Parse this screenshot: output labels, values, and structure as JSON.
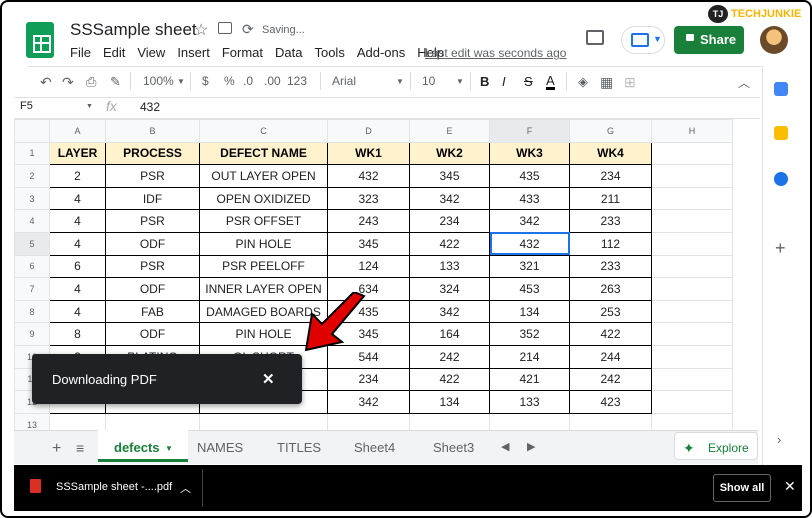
{
  "watermark": {
    "badge": "TJ",
    "brand": "TECHJUNKIE"
  },
  "header": {
    "title": "SSSample sheet",
    "saving": "Saving...",
    "last_edit": "Last edit was seconds ago",
    "share_label": "Share"
  },
  "menu": [
    "File",
    "Edit",
    "View",
    "Insert",
    "Format",
    "Data",
    "Tools",
    "Add-ons",
    "Help"
  ],
  "toolbar": {
    "zoom": "100%",
    "currency": "$",
    "percent": "%",
    "dec_less": ".0",
    "dec_more": ".00",
    "format_more": "123",
    "font": "Arial",
    "font_size": "10",
    "bold": "B",
    "italic": "I",
    "strike": "S",
    "text_color": "A"
  },
  "formula_bar": {
    "cell_ref": "F5",
    "fx": "fx",
    "value": "432"
  },
  "grid": {
    "column_letters": [
      "A",
      "B",
      "C",
      "D",
      "E",
      "F",
      "G",
      "H"
    ],
    "row_numbers": [
      "1",
      "2",
      "3",
      "4",
      "5",
      "6",
      "7",
      "8",
      "9",
      "10",
      "11",
      "12",
      "13"
    ],
    "header": [
      "LAYER",
      "PROCESS",
      "DEFECT NAME",
      "WK1",
      "WK2",
      "WK3",
      "WK4"
    ],
    "rows": [
      [
        "2",
        "PSR",
        "OUT LAYER OPEN",
        "432",
        "345",
        "435",
        "234"
      ],
      [
        "4",
        "IDF",
        "OPEN OXIDIZED",
        "323",
        "342",
        "433",
        "211"
      ],
      [
        "4",
        "PSR",
        "PSR OFFSET",
        "243",
        "234",
        "342",
        "233"
      ],
      [
        "4",
        "ODF",
        "PIN HOLE",
        "345",
        "422",
        "432",
        "112"
      ],
      [
        "6",
        "PSR",
        "PSR PEELOFF",
        "124",
        "133",
        "321",
        "233"
      ],
      [
        "4",
        "ODF",
        "INNER LAYER OPEN",
        "634",
        "324",
        "453",
        "263"
      ],
      [
        "4",
        "FAB",
        "DAMAGED BOARDS",
        "435",
        "342",
        "134",
        "253"
      ],
      [
        "8",
        "ODF",
        "PIN HOLE",
        "345",
        "164",
        "352",
        "422"
      ],
      [
        "2",
        "PLATING",
        "OL SHORT",
        "544",
        "242",
        "214",
        "244"
      ],
      [
        "",
        "",
        "DS",
        "234",
        "422",
        "421",
        "242"
      ],
      [
        "",
        "",
        "",
        "342",
        "134",
        "133",
        "423"
      ]
    ]
  },
  "sheet_tabs": {
    "active": "defects",
    "others": [
      "NAMES",
      "TITLES",
      "Sheet4",
      "Sheet3"
    ],
    "explore": "Explore"
  },
  "toast": {
    "message": "Downloading PDF",
    "close": "✕"
  },
  "download_bar": {
    "file": "SSSample sheet -....pdf",
    "show_all": "Show all",
    "close": "✕"
  },
  "colors": {
    "green": "#188038",
    "header_fill": "#fff2cc",
    "selection": "#1a73e8"
  }
}
